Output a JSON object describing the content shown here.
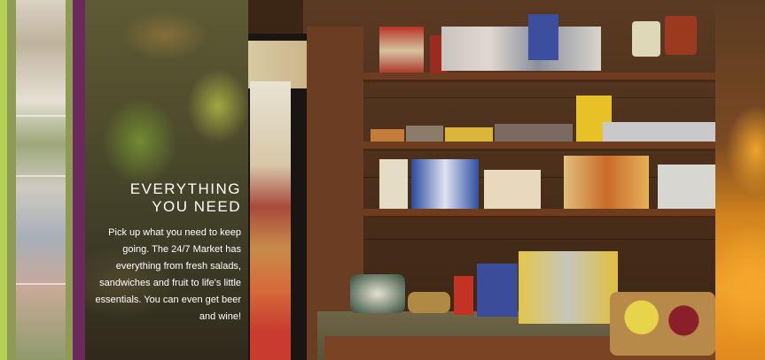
{
  "banner": {
    "heading_line1": "EVERYTHING",
    "heading_line2": "YOU NEED",
    "description": "Pick up what you need to keep going. The 24/7 Market has everything from fresh salads, sandwiches and fruit to life's little essentials. You can even get beer and wine!"
  },
  "colors": {
    "accent_purple": "#6b2a5c",
    "accent_lime": "#b6cf55",
    "wood": "#6e3d20",
    "orange": "#f0a12a"
  }
}
